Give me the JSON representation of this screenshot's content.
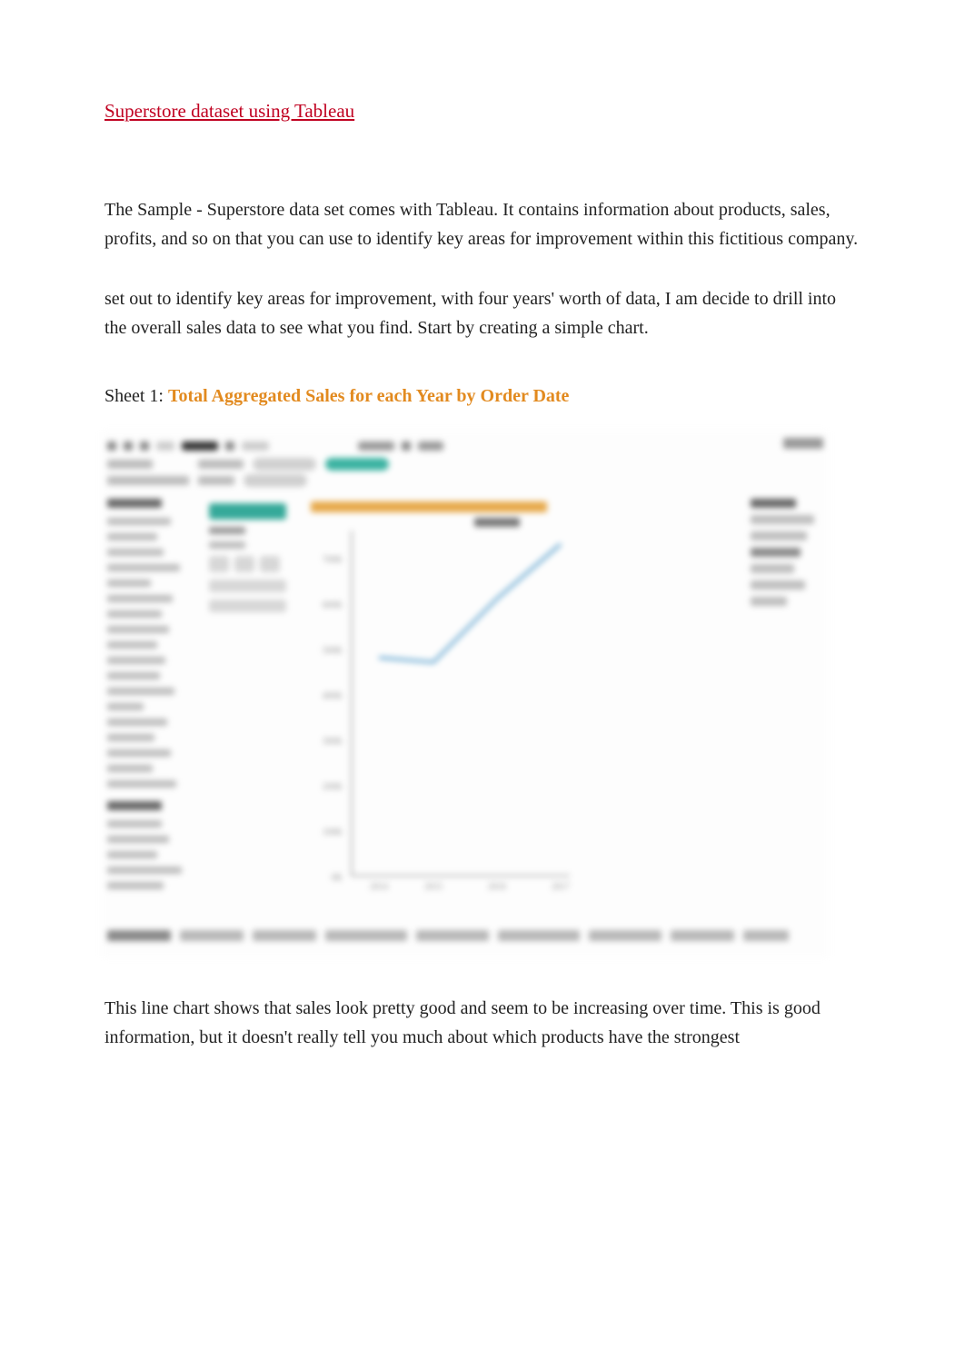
{
  "title": "Superstore dataset using Tableau",
  "para1": "The Sample - Superstore data set comes with Tableau. It contains information about products, sales, profits, and so on that you can use to identify key areas for improvement within this fictitious company.",
  "para2": "set out to identify key areas for improvement, with four years' worth of data, I am decide to drill into the overall sales data to see what you find. Start by creating a simple chart.",
  "sheet_prefix": "Sheet 1: ",
  "sheet_title": "Total Aggregated Sales for each Year by Order Date",
  "caption": "This line chart shows that sales look pretty good and seem to be increasing over time. This is good information, but it doesn't really tell you much about which products have the strongest",
  "chart_data": {
    "type": "line",
    "title": "Total Aggregated Sales for each Year by Order Date",
    "xlabel": "Order Date",
    "ylabel": "Sales",
    "x": [
      2014,
      2015,
      2016,
      2017
    ],
    "values": [
      480000,
      470000,
      610000,
      730000
    ],
    "ylim": [
      0,
      800000
    ],
    "x_ticks": [
      "2014",
      "2015",
      "2016",
      "2017"
    ],
    "y_ticks": [
      "0K",
      "100K",
      "200K",
      "300K",
      "400K",
      "500K",
      "600K",
      "700K"
    ]
  }
}
